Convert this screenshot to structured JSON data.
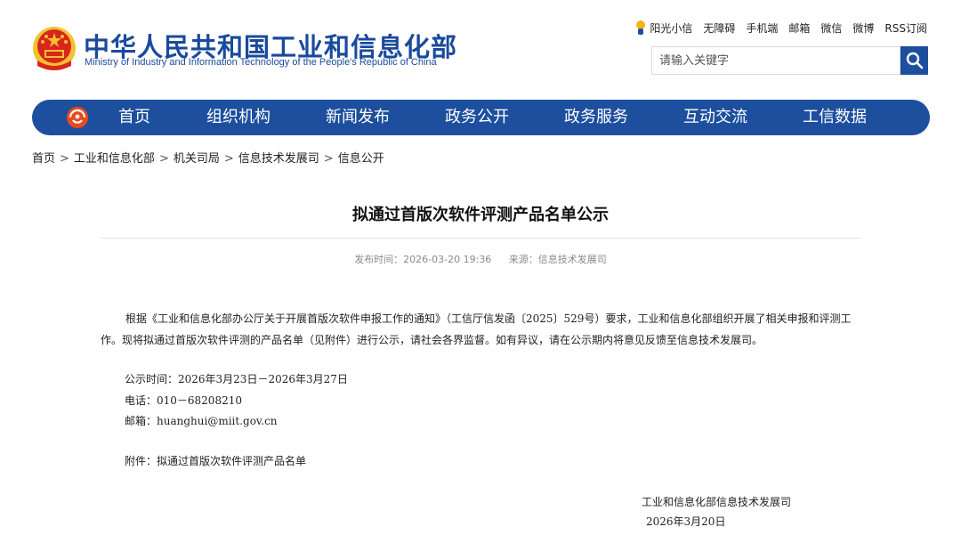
{
  "header": {
    "site_title": "中华人民共和国工业和信息化部",
    "site_subtitle": "Ministry of Industry and Information Technology of the People's Republic of China",
    "top_links": [
      "阳光小信",
      "无障碍",
      "手机端",
      "邮箱",
      "微信",
      "微博",
      "RSS订阅"
    ],
    "search_placeholder": "请输入关键字"
  },
  "nav": {
    "items": [
      "首页",
      "组织机构",
      "新闻发布",
      "政务公开",
      "政务服务",
      "互动交流",
      "工信数据"
    ]
  },
  "breadcrumb": [
    "首页",
    "工业和信息化部",
    "机关司局",
    "信息技术发展司",
    "信息公开"
  ],
  "article": {
    "title": "拟通过首版次软件评测产品名单公示",
    "publish_time": "发布时间：2026-03-20 19:36",
    "source": "来源：信息技术发展司",
    "paragraph": "根据《工业和信息化部办公厅关于开展首版次软件申报工作的通知》（工信厅信发函〔2025〕529号）要求，工业和信息化部组织开展了相关申报和评测工作。现将拟通过首版次软件评测的产品名单（见附件）进行公示，请社会各界监督。如有异议，请在公示期内将意见反馈至信息技术发展司。",
    "notice_period": "公示时间：2026年3月23日－2026年3月27日",
    "phone": "电话：010－68208210",
    "email": "邮箱：huanghui@miit.gov.cn",
    "attachment": "附件：拟通过首版次软件评测产品名单",
    "signature_org": "工业和信息化部信息技术发展司",
    "signature_date": "2026年3月20日"
  },
  "colors": {
    "brand_blue": "#1d4f9e",
    "emblem_red": "#d9261c",
    "emblem_gold": "#f2c230"
  }
}
